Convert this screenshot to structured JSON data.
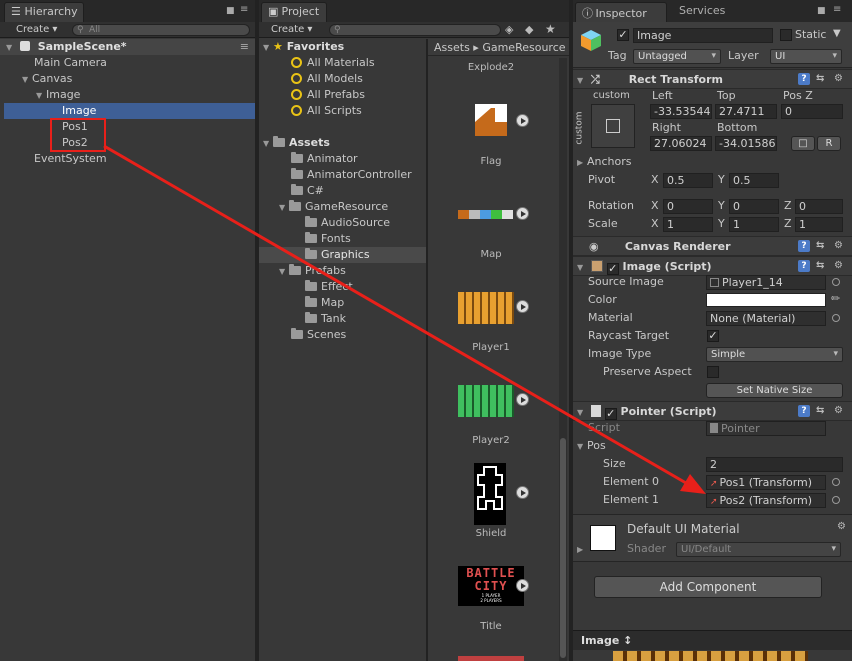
{
  "hierarchy": {
    "tab_label": "Hierarchy",
    "create_label": "Create",
    "search_placeholder": "All",
    "scene_name": "SampleScene*",
    "items": [
      "Main Camera",
      "Canvas",
      "Image",
      "Image",
      "Pos1",
      "Pos2",
      "EventSystem"
    ]
  },
  "project": {
    "tab_label": "Project",
    "create_label": "Create",
    "favorites_label": "Favorites",
    "favorites": [
      "All Materials",
      "All Models",
      "All Prefabs",
      "All Scripts"
    ],
    "assets_label": "Assets",
    "folders": [
      "Animator",
      "AnimatorController",
      "C#",
      "GameResource",
      "AudioSource",
      "Fonts",
      "Graphics",
      "Prefabs",
      "Effect",
      "Map",
      "Tank",
      "Scenes"
    ],
    "breadcrumb": [
      "Assets",
      "GameResource"
    ],
    "grid_items": [
      "Explode2",
      "Flag",
      "Map",
      "Player1",
      "Player2",
      "Shield",
      "Title"
    ],
    "title_art_text": "BATTLE CITY",
    "title_art_sub": "1 PLAYER\n2 PLAYERS"
  },
  "inspector": {
    "tab_label": "Inspector",
    "services_label": "Services",
    "object_name": "Image",
    "static_label": "Static",
    "tag_label": "Tag",
    "tag_value": "Untagged",
    "layer_label": "Layer",
    "layer_value": "UI",
    "rect_transform": {
      "title": "Rect Transform",
      "mode_label": "custom",
      "side_label": "custom",
      "left_label": "Left",
      "left_value": "-33.53544",
      "top_label": "Top",
      "top_value": "27.4711",
      "posz_label": "Pos Z",
      "posz_value": "0",
      "right_label": "Right",
      "right_value": "27.06024",
      "bottom_label": "Bottom",
      "bottom_value": "-34.01586",
      "r_button": "R",
      "anchors_label": "Anchors",
      "pivot_label": "Pivot",
      "pivot_x": "0.5",
      "pivot_y": "0.5",
      "rotation_label": "Rotation",
      "rot_x": "0",
      "rot_y": "0",
      "rot_z": "0",
      "scale_label": "Scale",
      "scale_x": "1",
      "scale_y": "1",
      "scale_z": "1",
      "x": "X",
      "y": "Y",
      "z": "Z"
    },
    "canvas_renderer": {
      "title": "Canvas Renderer"
    },
    "image_script": {
      "title": "Image (Script)",
      "source_image_label": "Source Image",
      "source_image_value": "Player1_14",
      "color_label": "Color",
      "color_value": "#ffffff",
      "material_label": "Material",
      "material_value": "None (Material)",
      "raycast_label": "Raycast Target",
      "image_type_label": "Image Type",
      "image_type_value": "Simple",
      "preserve_label": "Preserve Aspect",
      "native_size_button": "Set Native Size"
    },
    "pointer_script": {
      "title": "Pointer (Script)",
      "script_label": "Script",
      "script_value": "Pointer",
      "pos_label": "Pos",
      "size_label": "Size",
      "size_value": "2",
      "element0_label": "Element 0",
      "element0_value": "Pos1 (Transform)",
      "element1_label": "Element 1",
      "element1_value": "Pos2 (Transform)"
    },
    "material": {
      "name": "Default UI Material",
      "shader_label": "Shader",
      "shader_value": "UI/Default"
    },
    "add_component": "Add Component",
    "preview_label": "Image ↕"
  },
  "colors": {
    "selection": "#3e5f96",
    "annotation_red": "#e8201a",
    "folder_gold": "#e9c316"
  }
}
